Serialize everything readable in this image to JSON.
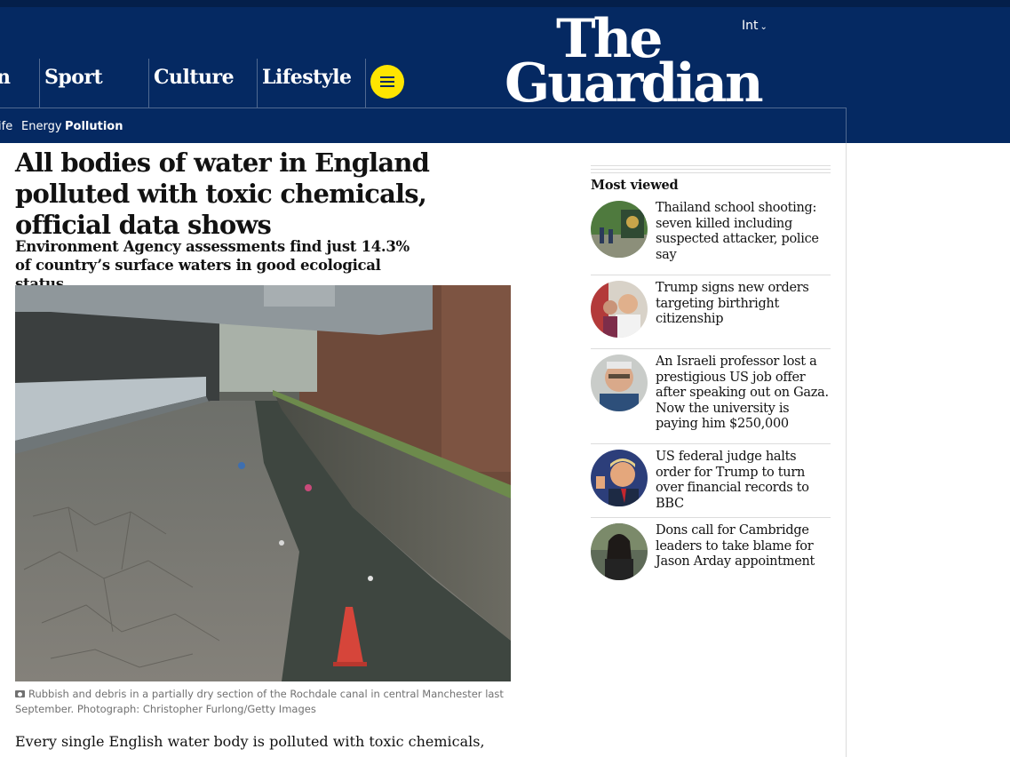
{
  "header": {
    "edition": "Int",
    "logo_line1": "The",
    "logo_line2": "Guardian",
    "pillars": [
      "n",
      "Sport",
      "Culture",
      "Lifestyle"
    ],
    "subnav": [
      "ife",
      "Energy",
      "Pollution"
    ]
  },
  "article": {
    "headline": "All bodies of water in England polluted with toxic chemicals, official data shows",
    "standfirst": "Environment Agency assessments find just 14.3% of country’s surface waters in good ecological status",
    "caption": "Rubbish and debris in a partially dry section of the Rochdale canal in central Manchester last September. Photograph: Christopher Furlong/Getty Images",
    "body_first_line": "Every single English water body is polluted with toxic chemicals, new"
  },
  "most_viewed": {
    "title": "Most viewed",
    "items": [
      {
        "text": "Thailand school shooting: seven killed including suspected attacker, police say"
      },
      {
        "text": "Trump signs new orders targeting birthright citizenship"
      },
      {
        "text": "An Israeli professor lost a prestigious US job offer after speaking out on Gaza. Now the university is paying him $250,000"
      },
      {
        "text": "US federal judge halts order for Trump to turn over financial records to BBC"
      },
      {
        "text": "Dons call for Cambridge leaders to take blame for Jason Arday appointment"
      }
    ]
  },
  "colors": {
    "brand_blue": "#052962",
    "menu_yellow": "#ffe500"
  }
}
